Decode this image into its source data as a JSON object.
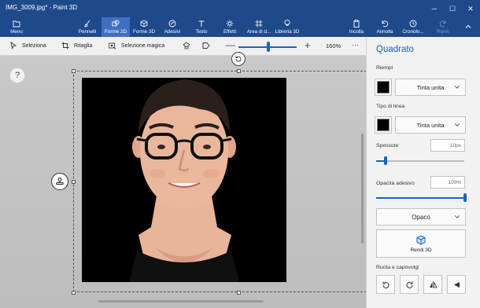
{
  "window": {
    "title": "IMG_3009.jpg* - Paint 3D",
    "minimize_icon": "─",
    "maximize_icon": "☐",
    "close_icon": "✕"
  },
  "ribbon": {
    "menu": "Menu",
    "tools": [
      {
        "label": "Pennelli",
        "icon": "brush-icon"
      },
      {
        "label": "Forme 2D",
        "icon": "shapes-2d-icon",
        "active": true
      },
      {
        "label": "Forme 3D",
        "icon": "shapes-3d-icon"
      },
      {
        "label": "Adesivi",
        "icon": "sticker-icon"
      },
      {
        "label": "Testo",
        "icon": "text-icon"
      },
      {
        "label": "Effetti",
        "icon": "effects-icon"
      },
      {
        "label": "Area di d...",
        "icon": "canvas-icon"
      },
      {
        "label": "Libreria 3D",
        "icon": "library-3d-icon"
      }
    ],
    "right": [
      {
        "label": "Incolla",
        "icon": "paste-icon"
      },
      {
        "label": "Annulla",
        "icon": "undo-icon"
      },
      {
        "label": "Cronolo...",
        "icon": "history-icon"
      },
      {
        "label": "Ripeti",
        "icon": "redo-icon",
        "disabled": true
      }
    ],
    "colors": {
      "ribbon_bg": "#1e4a8c",
      "active_bg": "#3f6fc2"
    }
  },
  "subbar": {
    "select": "Seleziona",
    "crop": "Ritaglia",
    "magic_select": "Selezione magica",
    "zoom": "160%",
    "more": "···",
    "zoom_out": "—",
    "zoom_in": "+",
    "zoom_slider_level": 0.5
  },
  "canvas": {
    "help": "?",
    "photo_description_icon": "portrait-photo"
  },
  "panel": {
    "title": "Quadrato",
    "fill_label": "Riempi",
    "fill_value": "Tinta unita",
    "fill_color": "#000000",
    "line_label": "Tipo di linea",
    "line_value": "Tinta unita",
    "line_color": "#000000",
    "thickness_label": "Spessore",
    "thickness_value": "10px",
    "thickness_level": 0.08,
    "opacity_label": "Opacità adesivo",
    "opacity_value": "100%",
    "opacity_level": 1.0,
    "finish_value": "Opaco",
    "make3d_label": "Rendi 3D",
    "rotate_label": "Ruota e capovolgi",
    "accent": "#1565c0"
  }
}
